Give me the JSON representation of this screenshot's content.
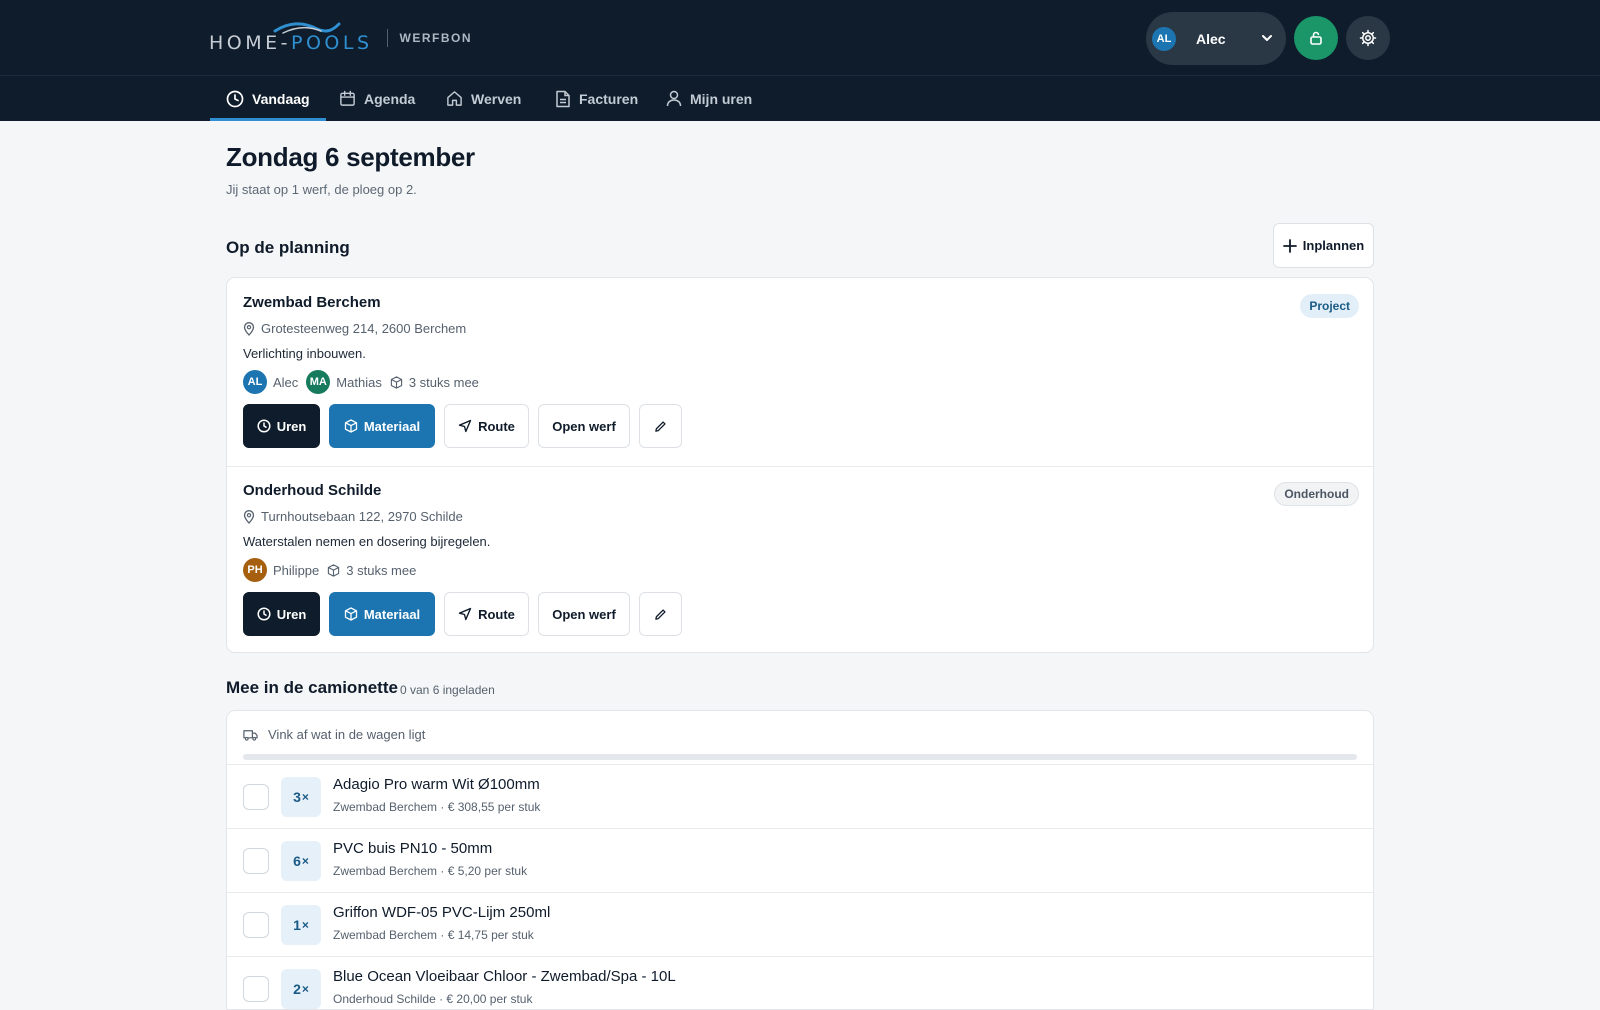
{
  "brand": {
    "logo_home": "HOME-",
    "logo_pools": "POOLS",
    "app_name": "WERFBON"
  },
  "user": {
    "initials": "AL",
    "name": "Alec"
  },
  "nav": {
    "tabs": [
      {
        "label": "Vandaag",
        "icon": "clock-icon",
        "active": true
      },
      {
        "label": "Agenda",
        "icon": "calendar-icon"
      },
      {
        "label": "Werven",
        "icon": "home-icon"
      },
      {
        "label": "Facturen",
        "icon": "document-icon"
      },
      {
        "label": "Mijn uren",
        "icon": "user-icon"
      }
    ]
  },
  "page": {
    "title": "Zondag 6 september",
    "subtitle": "Jij staat op 1 werf, de ploeg op 2."
  },
  "planning": {
    "title": "Op de planning",
    "add_label": "Inplannen",
    "jobs": [
      {
        "title": "Zwembad Berchem",
        "address": "Grotesteenweg 214, 2600 Berchem",
        "description": "Verlichting inbouwen.",
        "badge": "Project",
        "people": [
          {
            "initials": "AL",
            "name": "Alec",
            "color": "#1c75b0"
          },
          {
            "initials": "MA",
            "name": "Mathias",
            "color": "#167a5c"
          }
        ],
        "items_text": "3 stuks mee"
      },
      {
        "title": "Onderhoud Schilde",
        "address": "Turnhoutsebaan 122, 2970 Schilde",
        "description": "Waterstalen nemen en dosering bijregelen.",
        "badge": "Onderhoud",
        "people": [
          {
            "initials": "PH",
            "name": "Philippe",
            "color": "#a55f0e"
          }
        ],
        "items_text": "3 stuks mee"
      }
    ],
    "actions": {
      "uren": "Uren",
      "materiaal": "Materiaal",
      "route": "Route",
      "open": "Open werf"
    }
  },
  "camionette": {
    "title": "Mee in de camionette",
    "count_text": "0 van 6 ingeladen",
    "loaded_fraction": 0,
    "hint": "Vink af wat in de wagen ligt",
    "items": [
      {
        "qty": "3",
        "name": "Adagio Pro warm Wit Ø100mm",
        "meta": "Zwembad Berchem · € 308,55 per stuk"
      },
      {
        "qty": "6",
        "name": "PVC buis PN10 - 50mm",
        "meta": "Zwembad Berchem · € 5,20 per stuk"
      },
      {
        "qty": "1",
        "name": "Griffon WDF-05 PVC-Lijm 250ml",
        "meta": "Zwembad Berchem · € 14,75 per stuk"
      },
      {
        "qty": "2",
        "name": "Blue Ocean Vloeibaar Chloor - Zwembad/Spa - 10L",
        "meta": "Onderhoud Schilde · € 20,00 per stuk"
      }
    ],
    "qty_suffix": "×"
  },
  "colors": {
    "topbar": "#0e1c2b",
    "accent": "#1c75b0",
    "lock_button": "#1a9669"
  }
}
